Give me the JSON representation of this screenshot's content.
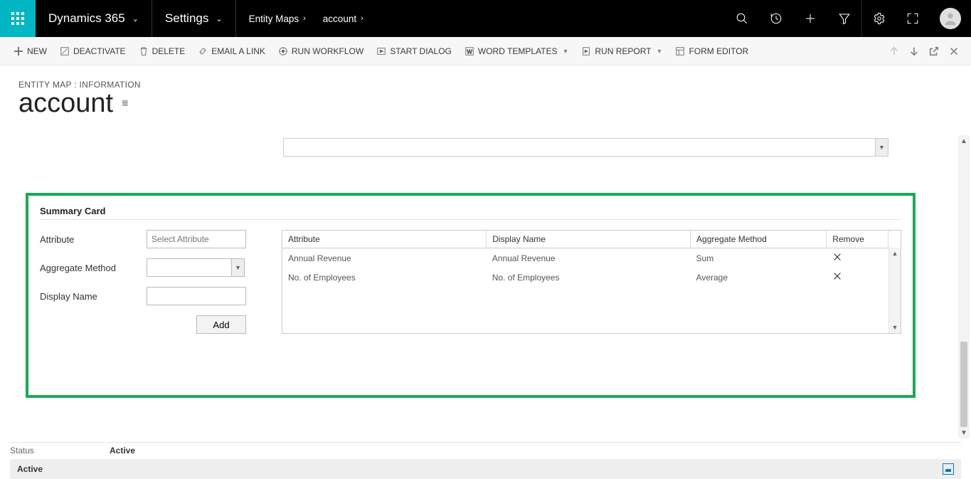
{
  "nav": {
    "brand": "Dynamics 365",
    "area": "Settings",
    "breadcrumb1": "Entity Maps",
    "breadcrumb2": "account"
  },
  "commands": {
    "new": "NEW",
    "deactivate": "DEACTIVATE",
    "delete": "DELETE",
    "emailLink": "EMAIL A LINK",
    "runWorkflow": "RUN WORKFLOW",
    "startDialog": "START DIALOG",
    "wordTemplates": "WORD TEMPLATES",
    "runReport": "RUN REPORT",
    "formEditor": "FORM EDITOR"
  },
  "header": {
    "type": "ENTITY MAP : INFORMATION",
    "title": "account"
  },
  "summary": {
    "section": "Summary Card",
    "labels": {
      "attribute": "Attribute",
      "aggregateMethod": "Aggregate Method",
      "displayName": "Display Name"
    },
    "attrPlaceholder": "Select Attribute",
    "addButton": "Add",
    "table": {
      "headers": {
        "attribute": "Attribute",
        "displayName": "Display Name",
        "aggregateMethod": "Aggregate Method",
        "remove": "Remove"
      },
      "rows": [
        {
          "attribute": "Annual Revenue",
          "displayName": "Annual Revenue",
          "aggregateMethod": "Sum"
        },
        {
          "attribute": "No. of Employees",
          "displayName": "No. of Employees",
          "aggregateMethod": "Average"
        }
      ]
    }
  },
  "status": {
    "label": "Status",
    "value": "Active",
    "footer": "Active"
  }
}
